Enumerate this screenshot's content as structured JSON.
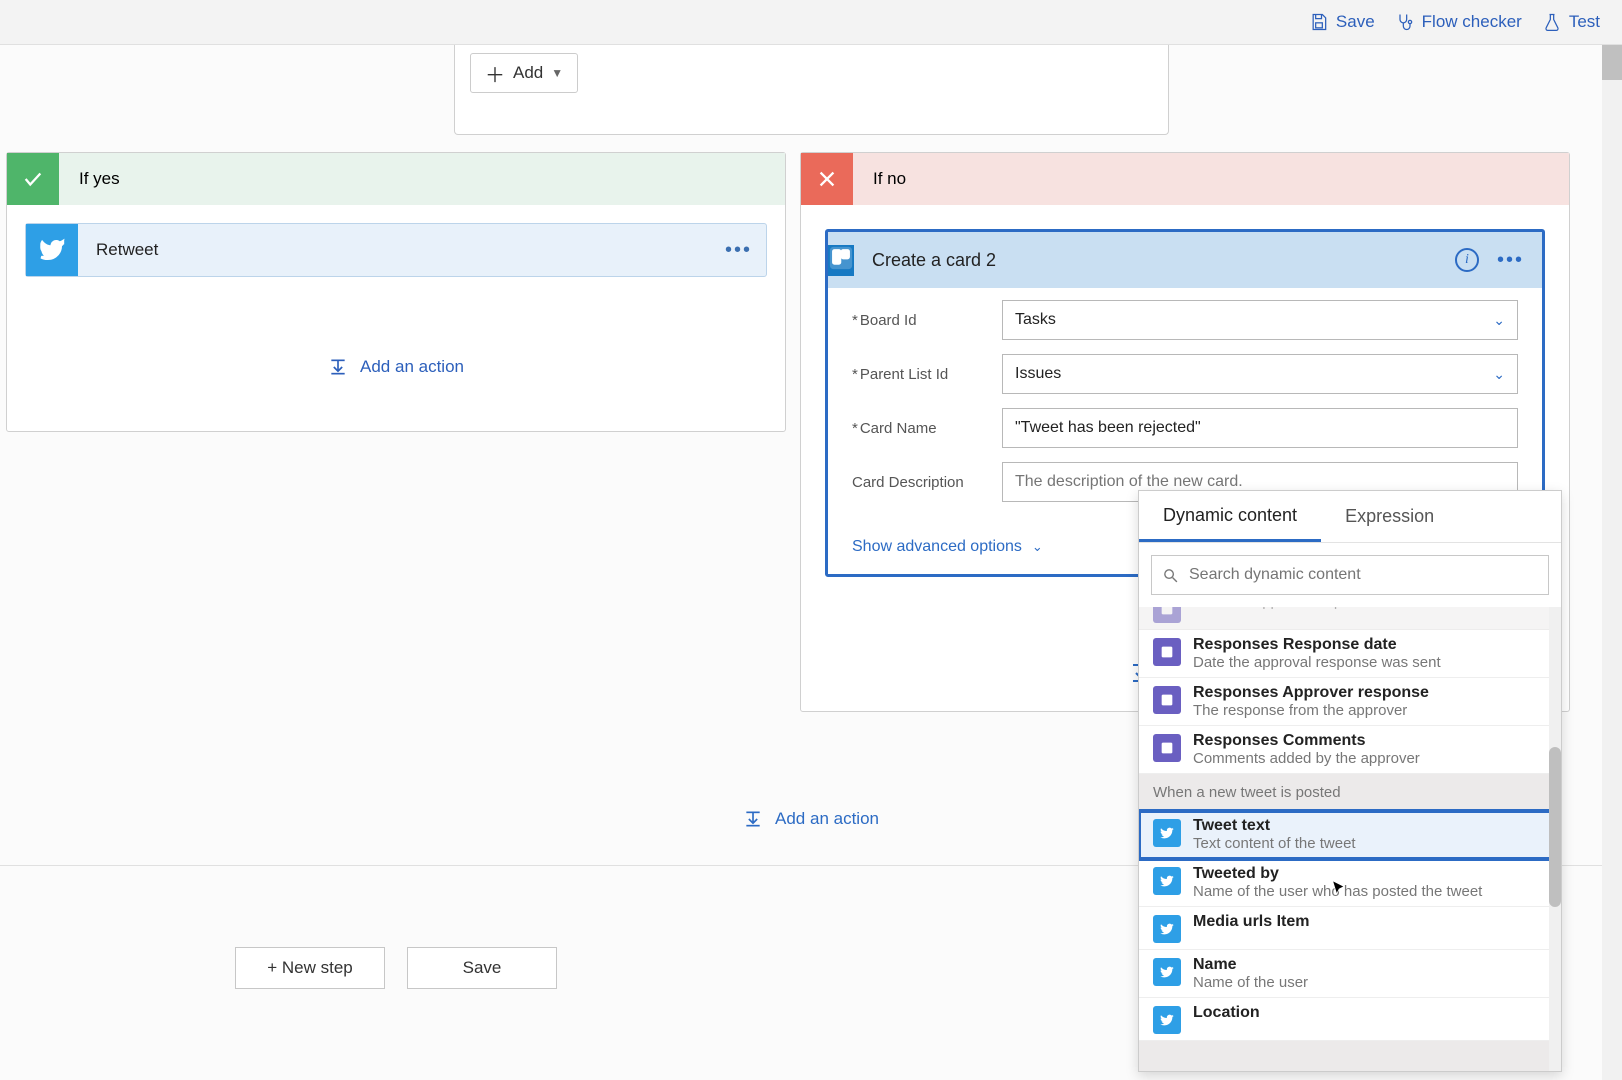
{
  "toolbar": {
    "save": "Save",
    "flow_checker": "Flow checker",
    "test": "Test"
  },
  "addcard": {
    "label": "Add"
  },
  "branches": {
    "yes": {
      "label": "If yes"
    },
    "no": {
      "label": "If no"
    }
  },
  "retweet": {
    "title": "Retweet"
  },
  "add_action": "Add an action",
  "trello": {
    "title": "Create a card 2",
    "fields": {
      "board_id_label": "Board Id",
      "board_id_value": "Tasks",
      "parent_list_label": "Parent List Id",
      "parent_list_value": "Issues",
      "card_name_label": "Card Name",
      "card_name_value": "\"Tweet has been rejected\"",
      "card_desc_label": "Card Description",
      "card_desc_placeholder": "The description of the new card."
    },
    "advanced": "Show advanced options"
  },
  "footer": {
    "new_step": "+ New step",
    "save": "Save"
  },
  "popover": {
    "tabs": {
      "dynamic": "Dynamic content",
      "expression": "Expression"
    },
    "search_placeholder": "Search dynamic content",
    "partial_top": "Date the approval request was sent",
    "items_approval": [
      {
        "title": "Responses Response date",
        "sub": "Date the approval response was sent"
      },
      {
        "title": "Responses Approver response",
        "sub": "The response from the approver"
      },
      {
        "title": "Responses Comments",
        "sub": "Comments added by the approver"
      }
    ],
    "group_tweet": "When a new tweet is posted",
    "items_tweet": [
      {
        "title": "Tweet text",
        "sub": "Text content of the tweet"
      },
      {
        "title": "Tweeted by",
        "sub": "Name of the user who has posted the tweet"
      },
      {
        "title": "Media urls Item",
        "sub": ""
      },
      {
        "title": "Name",
        "sub": "Name of the user"
      },
      {
        "title": "Location",
        "sub": ""
      }
    ]
  }
}
